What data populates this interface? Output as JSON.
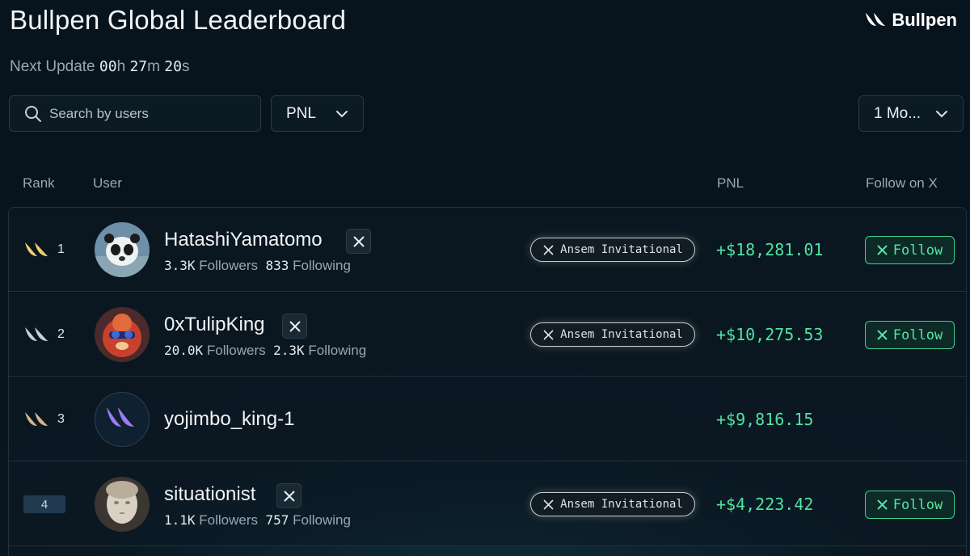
{
  "header": {
    "title": "Bullpen Global Leaderboard",
    "brand": "Bullpen",
    "next_update_label": "Next Update",
    "hh": "00",
    "hh_unit": "h",
    "mm": "27",
    "mm_unit": "m",
    "ss": "20",
    "ss_unit": "s"
  },
  "controls": {
    "search_placeholder": "Search by users",
    "metric_value": "PNL",
    "period_value": "1 Mo..."
  },
  "columns": {
    "rank": "Rank",
    "user": "User",
    "pnl": "PNL",
    "follow": "Follow on X"
  },
  "rows": [
    {
      "rank": "1",
      "name": "HatashiYamatomo",
      "followers": "3.3K",
      "followers_label": "Followers",
      "following": "833",
      "following_label": "Following",
      "tag": "Ansem Invitational",
      "pnl": "+$18,281.01",
      "follow": "Follow"
    },
    {
      "rank": "2",
      "name": "0xTulipKing",
      "followers": "20.0K",
      "followers_label": "Followers",
      "following": "2.3K",
      "following_label": "Following",
      "tag": "Ansem Invitational",
      "pnl": "+$10,275.53",
      "follow": "Follow"
    },
    {
      "rank": "3",
      "name": "yojimbo_king-1",
      "pnl": "+$9,816.15"
    },
    {
      "rank": "4",
      "name": "situationist",
      "followers": "1.1K",
      "followers_label": "Followers",
      "following": "757",
      "following_label": "Following",
      "tag": "Ansem Invitational",
      "pnl": "+$4,223.42",
      "follow": "Follow"
    }
  ],
  "colors": {
    "background": "#08141d",
    "accent_green": "#4fe3a0",
    "gold": "#f0d06a",
    "silver": "#c9cfd4",
    "bronze": "#d7b48e",
    "brand_purple": "#9b7bf0"
  }
}
